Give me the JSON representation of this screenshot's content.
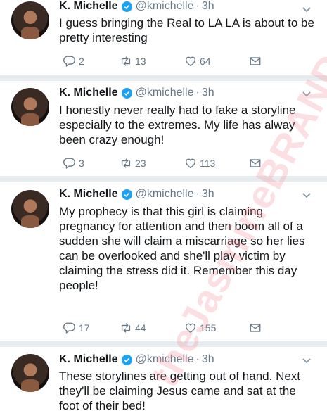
{
  "tweets": [
    {
      "name": "K. Michelle",
      "handle": "@kmichelle",
      "time": "3h",
      "text": "I guess bringing the Real to LA LA is about to be pretty interesting",
      "replies": "2",
      "retweets": "13",
      "likes": "64"
    },
    {
      "name": "K. Michelle",
      "handle": "@kmichelle",
      "time": "3h",
      "text": "I honestly never really had to fake a storyline especially to the extremes. My life has alway been crazy enough!",
      "replies": "3",
      "retweets": "23",
      "likes": "113"
    },
    {
      "name": "K. Michelle",
      "handle": "@kmichelle",
      "time": "3h",
      "text": "My prophecy is that this girl is claiming pregnancy for attention and then boom all of a sudden she will claim a miscarriage so her lies can be overlooked and she'll play victim by claiming the stress did it. Remember this day people!",
      "replies": "17",
      "retweets": "44",
      "likes": "155"
    },
    {
      "name": "K. Michelle",
      "handle": "@kmichelle",
      "time": "3h",
      "text": "These storylines are getting out of hand. Next they'll be claiming Jesus came and sat at the foot of their bed!"
    }
  ],
  "watermark": "theJasmineBRAND",
  "colors": {
    "verified": "#1da1f2",
    "muted": "#657786",
    "text": "#14171a",
    "separator": "#e6ecf0"
  },
  "icons": [
    "verified-badge-icon",
    "chevron-down-icon",
    "reply-icon",
    "retweet-icon",
    "like-icon",
    "message-icon"
  ]
}
